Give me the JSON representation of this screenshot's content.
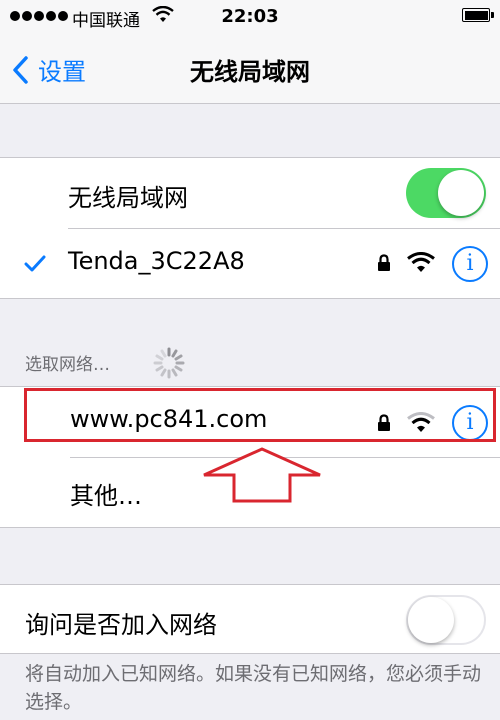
{
  "status_bar": {
    "carrier": "中国联通",
    "time": "22:03"
  },
  "nav": {
    "back_label": "设置",
    "title": "无线局域网"
  },
  "wifi_section": {
    "toggle_label": "无线局域网",
    "toggle_on": true,
    "connected_network": "Tenda_3C22A8"
  },
  "choose_network": {
    "header": "选取网络…",
    "networks": [
      {
        "name": "www.pc841.com",
        "locked": true
      }
    ],
    "other_label": "其他…"
  },
  "ask_to_join": {
    "label": "询问是否加入网络",
    "toggle_on": false,
    "note": "将自动加入已知网络。如果没有已知网络，您必须手动选择。"
  },
  "colors": {
    "accent": "#0a7bff",
    "toggle_on": "#4cd964",
    "highlight": "#d9262f"
  }
}
